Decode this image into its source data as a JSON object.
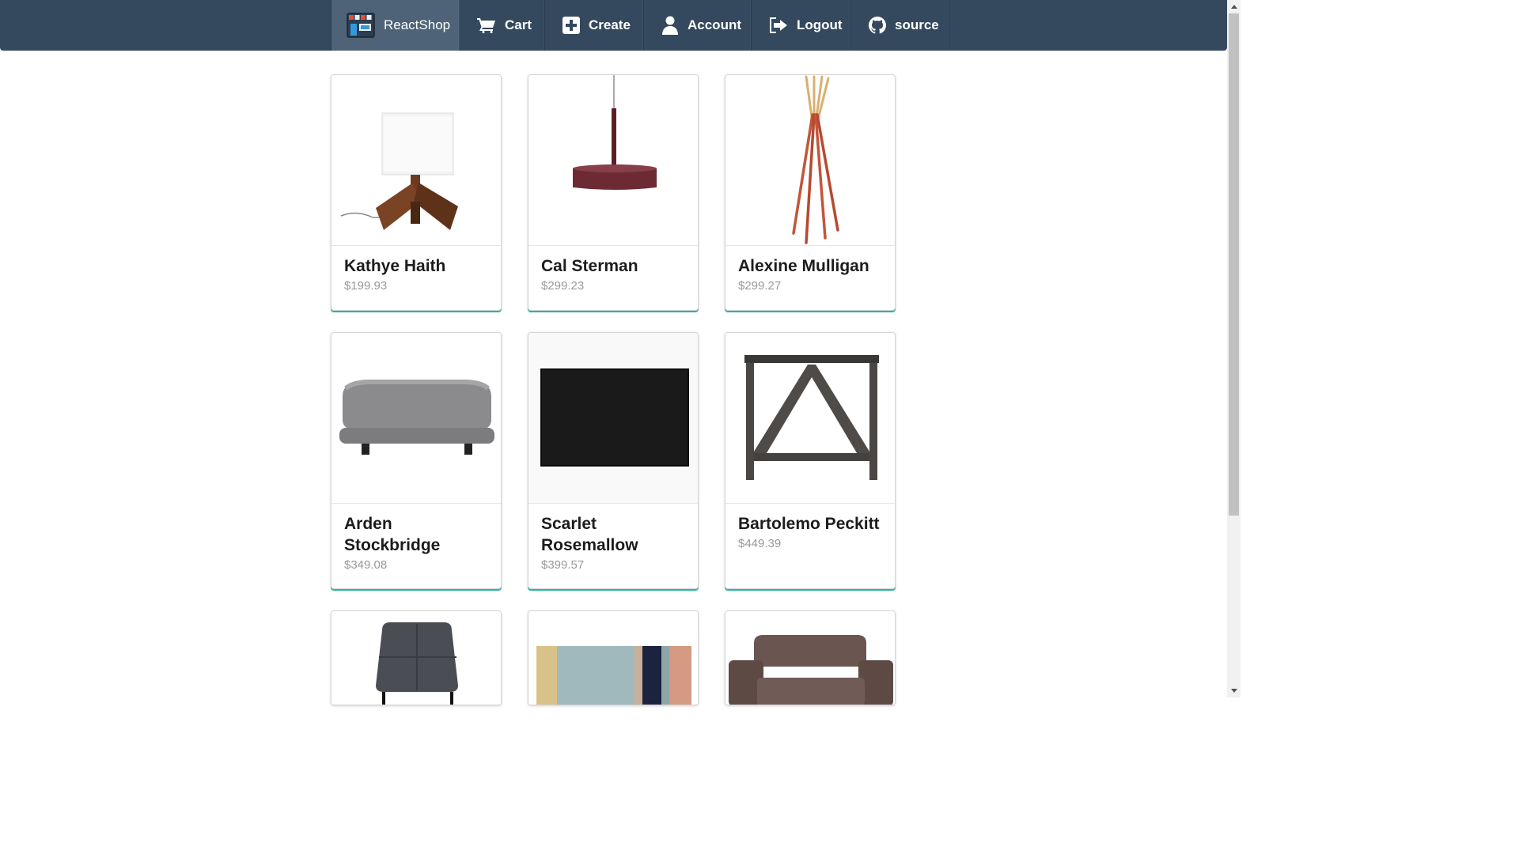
{
  "navbar": {
    "brand_label": "ReactShop",
    "items": [
      {
        "label": "Cart",
        "icon": "cart-icon"
      },
      {
        "label": "Create",
        "icon": "plus-square-icon"
      },
      {
        "label": "Account",
        "icon": "user-icon"
      },
      {
        "label": "Logout",
        "icon": "sign-out-icon"
      },
      {
        "label": "source",
        "icon": "github-icon"
      }
    ],
    "bg_color": "#34495e",
    "brand_bg_color": "#4e6378"
  },
  "products": [
    {
      "name": "Kathye Haith",
      "price": "$199.93",
      "image": "table-lamp"
    },
    {
      "name": "Cal Sterman",
      "price": "$299.23",
      "image": "pendant-lamp"
    },
    {
      "name": "Alexine Mulligan",
      "price": "$299.27",
      "image": "coat-rack"
    },
    {
      "name": "Arden Stockbridge",
      "price": "$349.08",
      "image": "ottoman"
    },
    {
      "name": "Scarlet Rosemallow",
      "price": "$399.57",
      "image": "black-rug"
    },
    {
      "name": "Bartolemo Peckitt",
      "price": "$449.39",
      "image": "side-table"
    },
    {
      "image": "gray-chair"
    },
    {
      "image": "striped-rug"
    },
    {
      "image": "brown-armchair"
    }
  ],
  "accent_color": "#21ba9f"
}
